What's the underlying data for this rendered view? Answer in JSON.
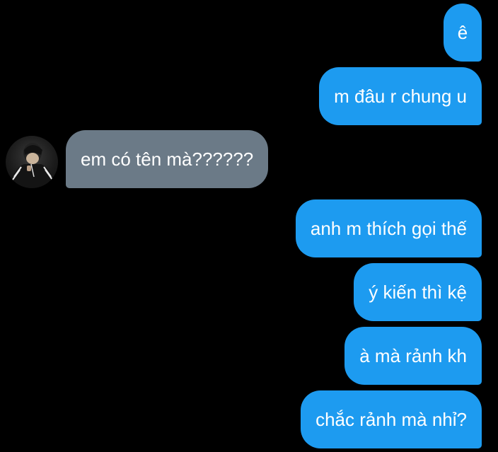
{
  "messages": [
    {
      "sender": "me",
      "text": "ê"
    },
    {
      "sender": "me",
      "text": "m đâu r chung u"
    },
    {
      "sender": "them",
      "text": "em có tên mà??????"
    },
    {
      "sender": "me",
      "text": "anh m thích gọi thế"
    },
    {
      "sender": "me",
      "text": "ý kiến thì kệ"
    },
    {
      "sender": "me",
      "text": "à mà rảnh kh"
    },
    {
      "sender": "me",
      "text": "chắc rảnh mà nhỉ?"
    }
  ],
  "colors": {
    "background": "#000000",
    "sent_bubble": "#1d9bf0",
    "received_bubble": "#6b7a87",
    "text": "#ffffff"
  },
  "icons": {
    "avatar": "contact-avatar-photo"
  }
}
